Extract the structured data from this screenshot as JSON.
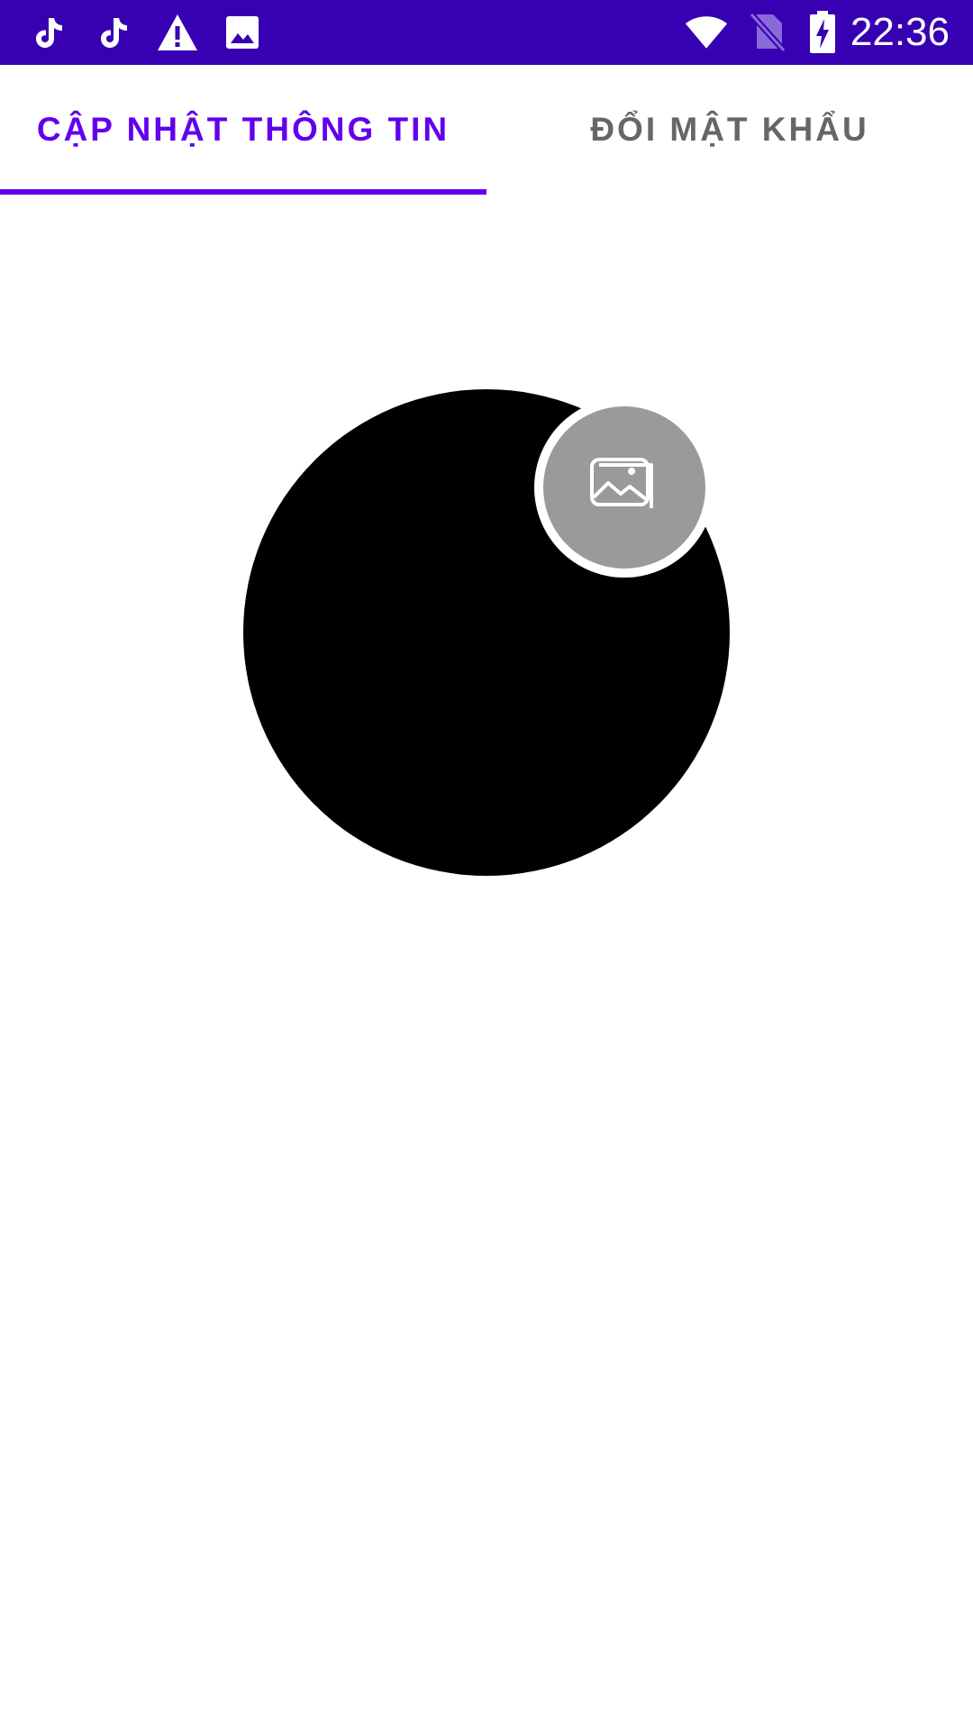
{
  "colors": {
    "status_bar": "#3700b3",
    "tab_active": "#6200ee",
    "tab_inactive": "#666666",
    "avatar_bg": "#000000",
    "picker_bg": "#9a9a9a"
  },
  "status_bar": {
    "left_icons": [
      "tiktok-icon",
      "tiktok-icon",
      "warning-icon",
      "image-icon"
    ],
    "right_icons": [
      "wifi-icon",
      "no-sim-icon",
      "battery-charging-icon"
    ],
    "time": "22:36"
  },
  "tabs": [
    {
      "label": "CẬP NHẬT THÔNG TIN",
      "active": true
    },
    {
      "label": "ĐỔI MẬT KHẨU",
      "active": false
    }
  ],
  "profile": {
    "avatar_icon": "avatar-placeholder",
    "picker_icon": "gallery-icon"
  }
}
